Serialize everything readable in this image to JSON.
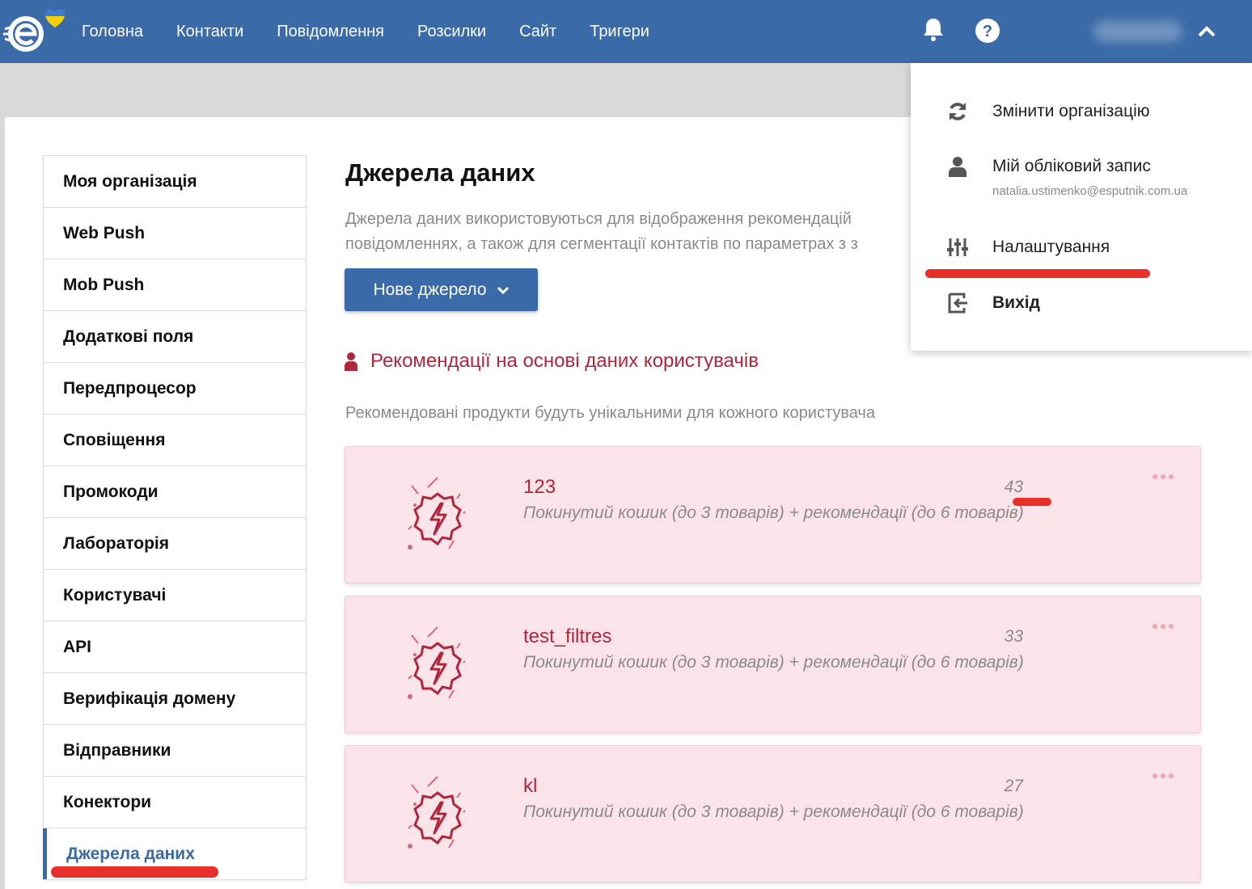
{
  "nav": {
    "items": [
      "Головна",
      "Контакти",
      "Повідомлення",
      "Розсилки",
      "Сайт",
      "Тригери"
    ]
  },
  "user_menu": {
    "change_org": "Змінити організацію",
    "account": "Мій обліковий запис",
    "email": "natalia.ustimenko@esputnik.com.ua",
    "settings": "Налаштування",
    "logout": "Вихід"
  },
  "sidebar": {
    "items": [
      "Моя організація",
      "Web Push",
      "Mob Push",
      "Додаткові поля",
      "Передпроцесор",
      "Сповіщення",
      "Промокоди",
      "Лабораторія",
      "Користувачі",
      "API",
      "Верифікація домену",
      "Відправники",
      "Конектори",
      "Джерела даних"
    ],
    "active_index": 13
  },
  "main": {
    "title": "Джерела даних",
    "description_line1": "Джерела даних використовуються для відображення рекомендацій",
    "description_line2": "повідомленнях, а також для сегментації контактів по параметрах з з",
    "new_source_button": "Нове джерело",
    "section_title": "Рекомендації на основі даних користувачів",
    "section_subtitle": "Рекомендовані продукти будуть унікальними для кожного користувача",
    "sources": [
      {
        "name": "123",
        "count": "43",
        "description": "Покинутий кошик (до 3 товарів) + рекомендації (до 6 товарів)"
      },
      {
        "name": "test_filtres",
        "count": "33",
        "description": "Покинутий кошик (до 3 товарів) + рекомендації (до 6 товарів)"
      },
      {
        "name": "kl",
        "count": "27",
        "description": "Покинутий кошик (до 3 товарів) + рекомендації (до 6 товарів)"
      }
    ]
  },
  "colors": {
    "primary": "#3a6aa8",
    "accent_red": "#b0263c",
    "card_bg": "#fbe4e9",
    "annotation_red": "#e8302a"
  },
  "icons": {
    "logo": "esputnik-logo",
    "bell": "bell-icon",
    "help": "help-icon",
    "chevron": "chevron-up-icon",
    "refresh": "refresh-icon",
    "user": "user-icon",
    "sliders": "sliders-icon",
    "logout": "logout-icon",
    "card": "lightning-badge-icon"
  }
}
